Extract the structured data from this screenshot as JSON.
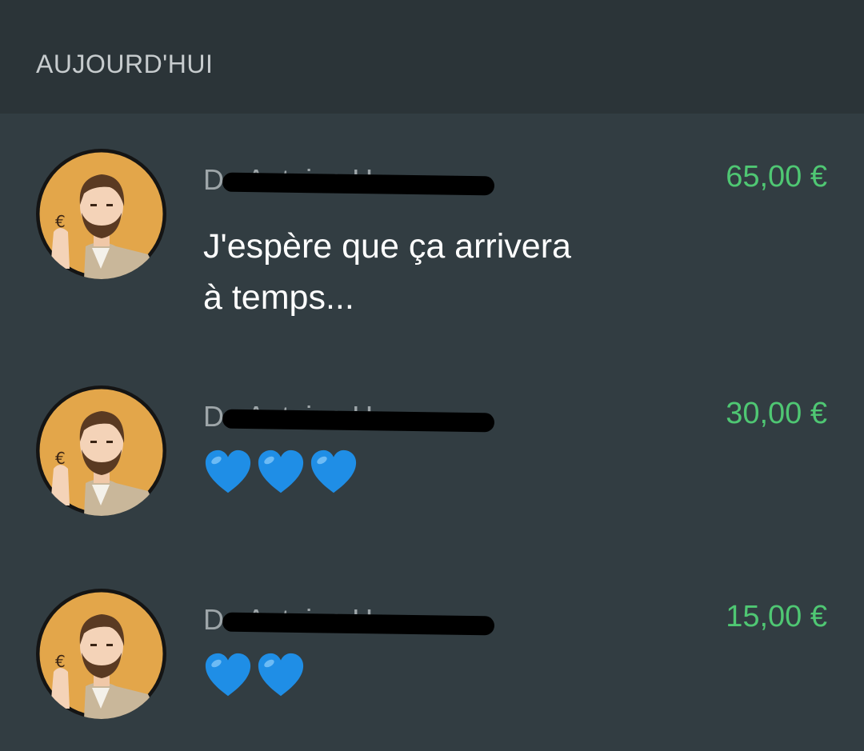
{
  "header": {
    "title": "AUJOURD'HUI"
  },
  "colors": {
    "background": "#323d42",
    "header": "#2b3438",
    "amount": "#4fc773",
    "heart": "#1f8ee6"
  },
  "donations": [
    {
      "sender": "De Antoine H.",
      "amount": "65,00 €",
      "message": "J'espère que ça arrivera\nà temps...",
      "hearts": 0,
      "avatar_icon": "bearded-man-avatar-icon"
    },
    {
      "sender": "De Antoine H.",
      "amount": "30,00 €",
      "message": "",
      "hearts": 3,
      "heart_icon": "blue-heart-icon"
    },
    {
      "sender": "De Antoine H.",
      "amount": "15,00 €",
      "message": "",
      "hearts": 2,
      "heart_icon": "blue-heart-icon"
    }
  ]
}
